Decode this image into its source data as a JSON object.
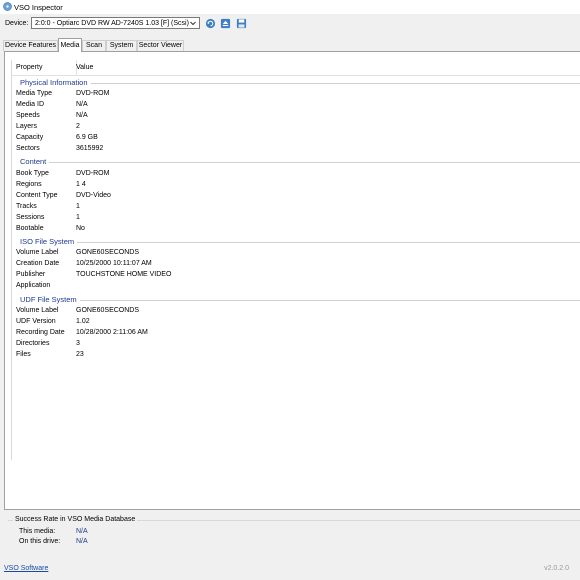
{
  "window": {
    "title": "VSO Inspector"
  },
  "device": {
    "label": "Device:",
    "selected": "2:0:0 - Optiarc DVD RW AD-7240S 1.03 [F] (Scsi)"
  },
  "tabs": [
    {
      "label": "Device Features",
      "active": false
    },
    {
      "label": "Media",
      "active": true
    },
    {
      "label": "Scan",
      "active": false
    },
    {
      "label": "System",
      "active": false
    },
    {
      "label": "Sector Viewer",
      "active": false
    }
  ],
  "table": {
    "columns": [
      "Property",
      "Value"
    ],
    "groups": [
      {
        "title": "Physical Information",
        "rows": [
          [
            "Media Type",
            "DVD-ROM"
          ],
          [
            "Media ID",
            "N/A"
          ],
          [
            "Speeds",
            "N/A"
          ],
          [
            "Layers",
            "2"
          ],
          [
            "Capacity",
            "6.9 GB"
          ],
          [
            "Sectors",
            "3615992"
          ]
        ]
      },
      {
        "title": "Content",
        "rows": [
          [
            "Book Type",
            "DVD-ROM"
          ],
          [
            "Regions",
            "1 4"
          ],
          [
            "Content Type",
            "DVD-Video"
          ],
          [
            "Tracks",
            "1"
          ],
          [
            "Sessions",
            "1"
          ],
          [
            "Bootable",
            "No"
          ]
        ]
      },
      {
        "title": "ISO File System",
        "rows": [
          [
            "Volume Label",
            "GONE60SECONDS"
          ],
          [
            "Creation Date",
            "10/25/2000 10:11:07 AM"
          ],
          [
            "Publisher",
            "TOUCHSTONE HOME VIDEO"
          ],
          [
            "Application",
            ""
          ]
        ]
      },
      {
        "title": "UDF File System",
        "rows": [
          [
            "Volume Label",
            "GONE60SECONDS"
          ],
          [
            "UDF Version",
            "1.02"
          ],
          [
            "Recording Date",
            "10/28/2000 2:11:06 AM"
          ],
          [
            "Directories",
            "3"
          ],
          [
            "Files",
            "23"
          ]
        ]
      }
    ]
  },
  "success_rate": {
    "title": "Success Rate in VSO Media Database",
    "this_media_label": "This media:",
    "this_media_value": "N/A",
    "this_drive_label": "On this drive:",
    "this_drive_value": "N/A"
  },
  "footer": {
    "link": "VSO Software",
    "version": "v2.0.2.0"
  },
  "icons": [
    "app-disc-icon",
    "chevron-down-icon",
    "refresh-icon",
    "eject-icon",
    "save-icon"
  ],
  "colors": {
    "group_title": "#1e3a8c",
    "link": "#1a4aa8",
    "version": "#9a9a9a"
  }
}
